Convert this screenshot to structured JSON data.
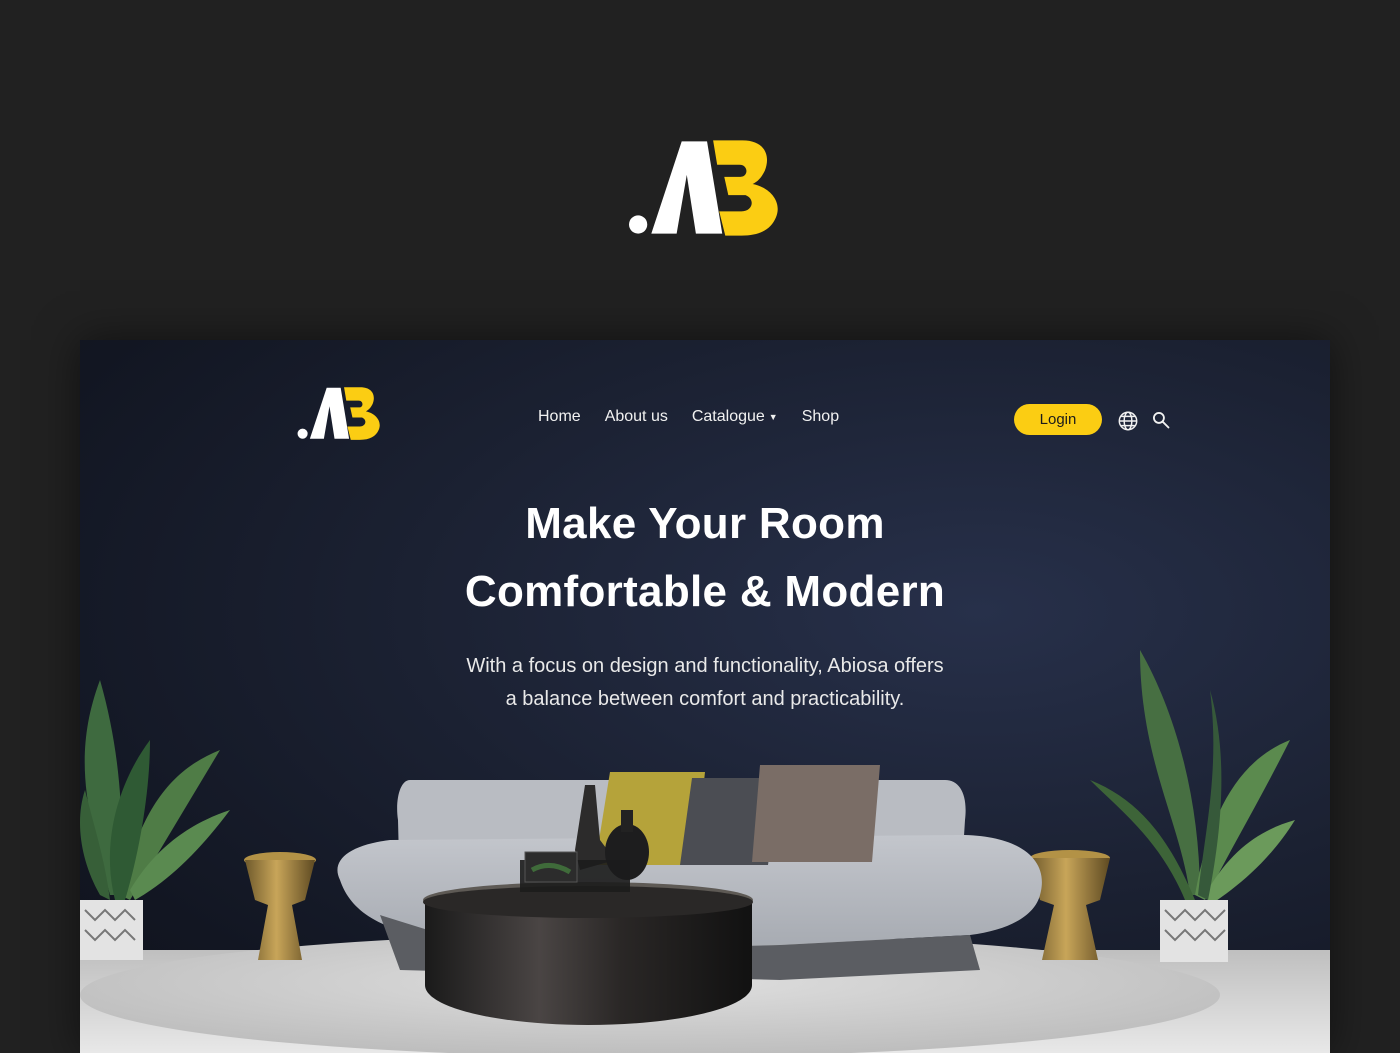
{
  "page": {
    "brand_colors": {
      "accent": "#fbcd13",
      "logo_white": "#ffffff",
      "backdrop": "#212121",
      "hero_bg": "#161b2a"
    }
  },
  "showcase_logo": {
    "icon": "ab-monogram-logo"
  },
  "navbar": {
    "logo_icon": "ab-monogram-logo",
    "links": [
      {
        "label": "Home"
      },
      {
        "label": "About us"
      },
      {
        "label": "Catalogue",
        "has_dropdown": true,
        "icon": "caret-down-icon"
      },
      {
        "label": "Shop"
      }
    ],
    "login_label": "Login",
    "globe_icon": "globe-icon",
    "search_icon": "search-icon"
  },
  "hero": {
    "title_lines": [
      "Make Your Room",
      "Comfortable & Modern"
    ],
    "subtitle_lines": [
      "With a focus on design and functionality, Abiosa offers",
      "a balance between comfort and practicability."
    ],
    "scene_image": "living-room-with-grey-sofa-coffee-table-and-plants"
  }
}
